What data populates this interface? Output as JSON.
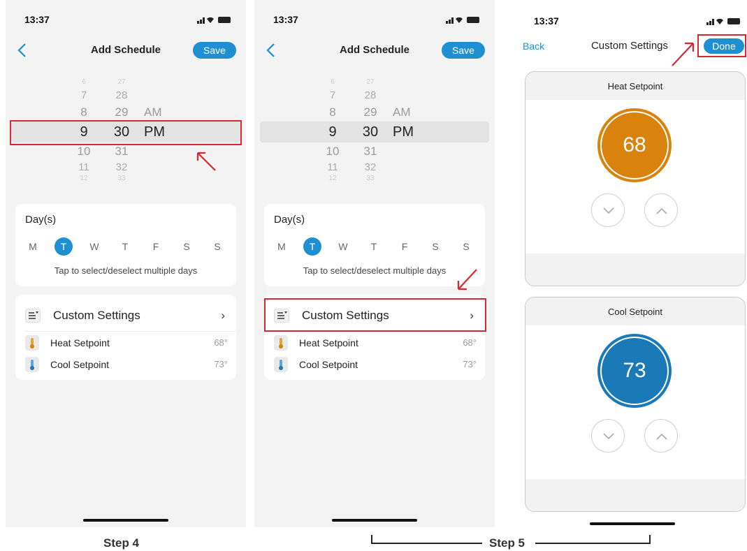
{
  "status": {
    "time": "13:37"
  },
  "schedule": {
    "title": "Add Schedule",
    "save_label": "Save",
    "picker": {
      "rows": [
        {
          "hour": "6",
          "minute": "27",
          "ampm": ""
        },
        {
          "hour": "7",
          "minute": "28",
          "ampm": ""
        },
        {
          "hour": "8",
          "minute": "29",
          "ampm": "AM"
        },
        {
          "hour": "9",
          "minute": "30",
          "ampm": "PM"
        },
        {
          "hour": "10",
          "minute": "31",
          "ampm": ""
        },
        {
          "hour": "11",
          "minute": "32",
          "ampm": ""
        },
        {
          "hour": "12",
          "minute": "33",
          "ampm": ""
        }
      ]
    },
    "days": {
      "title": "Day(s)",
      "items": [
        "M",
        "T",
        "W",
        "T",
        "F",
        "S",
        "S"
      ],
      "selected": "T",
      "hint": "Tap to select/deselect multiple days"
    },
    "custom": {
      "label": "Custom Settings",
      "chevron": "›",
      "heat_label": "Heat Setpoint",
      "heat_value": "68°",
      "cool_label": "Cool Setpoint",
      "cool_value": "73°"
    }
  },
  "custom_screen": {
    "back_label": "Back",
    "title": "Custom Settings",
    "done_label": "Done",
    "heat": {
      "label": "Heat Setpoint",
      "value": "68"
    },
    "cool": {
      "label": "Cool Setpoint",
      "value": "73"
    }
  },
  "steps": {
    "step4": "Step 4",
    "step5": "Step 5"
  },
  "colors": {
    "accent": "#1e8fd1",
    "heat": "#d9830c",
    "cool": "#1a79b7",
    "highlight": "#d62830"
  }
}
